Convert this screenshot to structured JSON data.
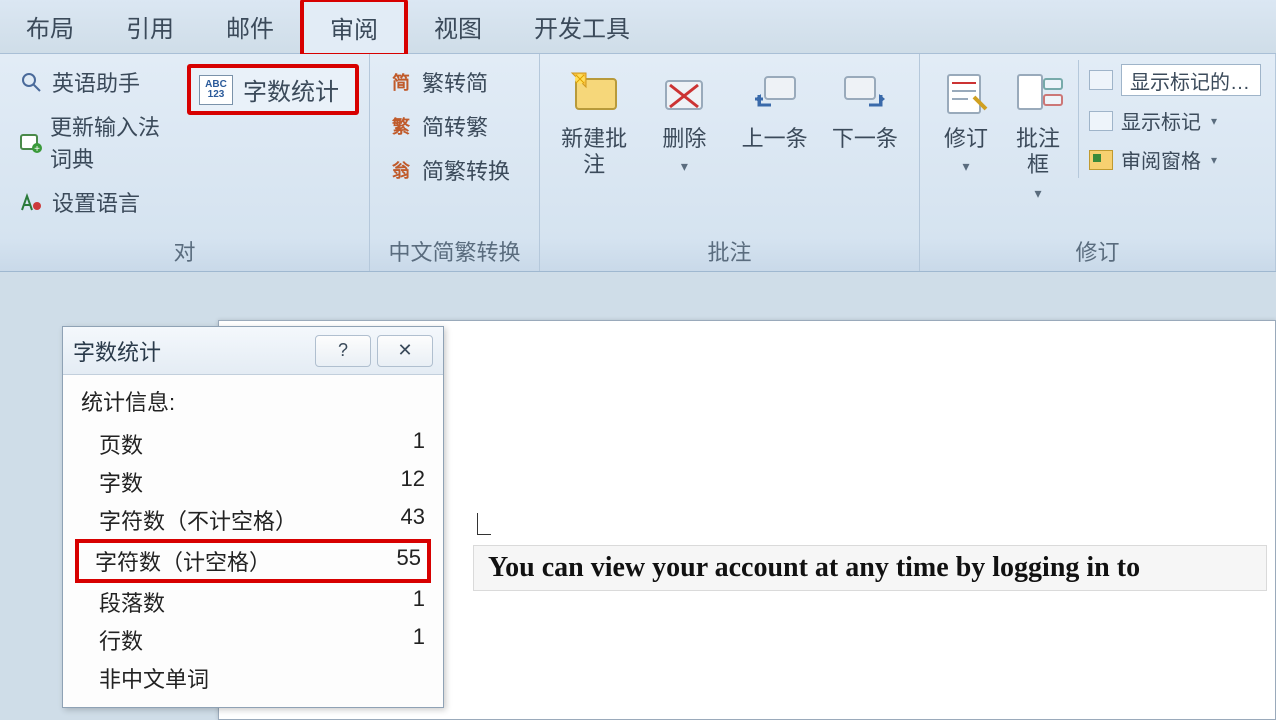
{
  "tabs": {
    "layout": "布局",
    "references": "引用",
    "mailings": "邮件",
    "review": "审阅",
    "view": "视图",
    "developer": "开发工具"
  },
  "ribbon": {
    "proofing": {
      "english_assistant": "英语助手",
      "update_ime_dict": "更新输入法词典",
      "set_language": "设置语言",
      "caption": "对"
    },
    "wordcount_btn": "字数统计",
    "chinese_conv": {
      "trad_to_simp": "繁转简",
      "simp_to_trad": "简转繁",
      "convert": "简繁转换",
      "caption": "中文简繁转换"
    },
    "comments": {
      "new_comment": "新建批注",
      "delete": "删除",
      "prev": "上一条",
      "next": "下一条",
      "caption": "批注"
    },
    "tracking": {
      "track_changes": "修订",
      "balloons": "批注框",
      "display_dropdown": "显示标记的…",
      "show_markup": "显示标记",
      "reviewing_pane": "审阅窗格",
      "caption": "修订"
    }
  },
  "dialog": {
    "title": "字数统计",
    "header": "统计信息:",
    "rows": {
      "pages_label": "页数",
      "pages_val": "1",
      "words_label": "字数",
      "words_val": "12",
      "chars_nospace_label": "字符数（不计空格）",
      "chars_nospace_val": "43",
      "chars_space_label": "字符数（计空格）",
      "chars_space_val": "55",
      "paragraphs_label": "段落数",
      "paragraphs_val": "1",
      "lines_label": "行数",
      "lines_val": "1",
      "noncjk_label": "非中文单词"
    }
  },
  "document": {
    "selected_text": "You can view your account at any time by logging in to"
  }
}
